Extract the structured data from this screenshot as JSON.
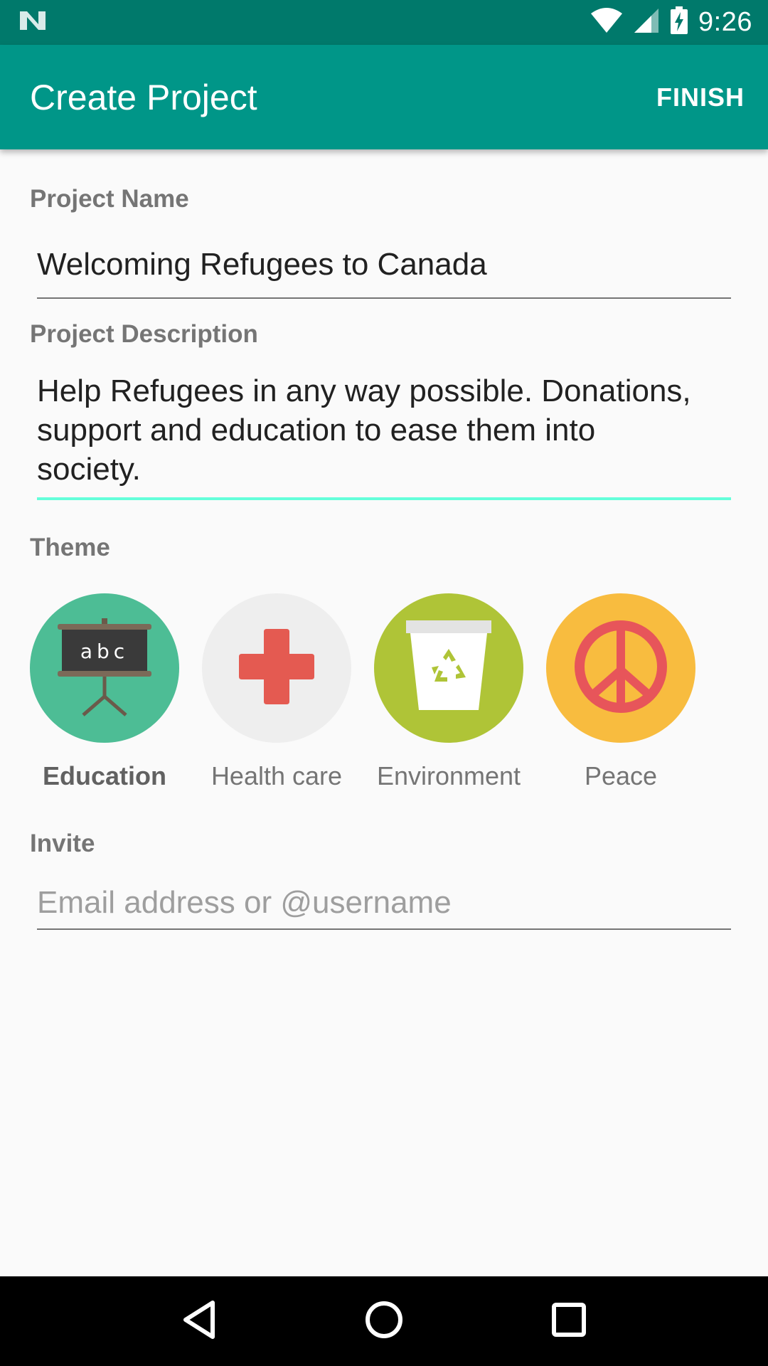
{
  "status_bar": {
    "time": "9:26",
    "icons": [
      "notification-n-icon",
      "wifi-icon",
      "cell-signal-icon",
      "battery-charging-icon"
    ]
  },
  "app_bar": {
    "title": "Create Project",
    "finish_label": "FINISH"
  },
  "form": {
    "project_name": {
      "label": "Project Name",
      "value": "Welcoming Refugees to Canada"
    },
    "project_description": {
      "label": "Project Description",
      "value_lines": [
        "Help Refugees in any way possible. Donations,",
        "support and education to ease them into",
        "society."
      ]
    },
    "theme": {
      "label": "Theme",
      "items": [
        {
          "label": "Education",
          "icon": "chalkboard-icon",
          "color": "#4dbd95",
          "selected": true
        },
        {
          "label": "Health care",
          "icon": "medical-cross-icon",
          "color": "#eeeeee",
          "selected": false
        },
        {
          "label": "Environment",
          "icon": "recycle-bin-icon",
          "color": "#afc437",
          "selected": false
        },
        {
          "label": "Peace",
          "icon": "peace-sign-icon",
          "color": "#f8bc3f",
          "selected": false
        }
      ]
    },
    "invite": {
      "label": "Invite",
      "placeholder": "Email address or @username"
    }
  },
  "colors": {
    "primary": "#009688",
    "primary_dark": "#00796b",
    "accent": "#64ffda"
  },
  "nav_bar": {
    "icons": [
      "back-icon",
      "home-icon",
      "recents-icon"
    ]
  }
}
